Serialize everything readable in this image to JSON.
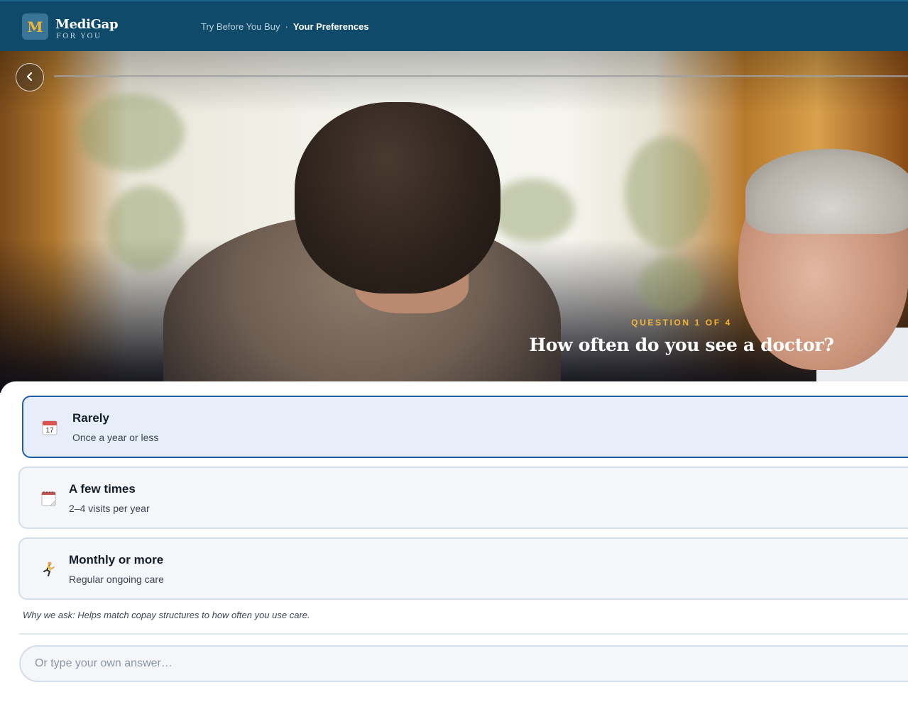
{
  "header": {
    "logo_letter": "M",
    "logo_name": "MediGap",
    "logo_sub": "FOR YOU",
    "breadcrumb": {
      "step1": "Try Before You Buy",
      "separator": "·",
      "step2": "Your Preferences"
    }
  },
  "hero": {
    "back_icon": "chevron-left-icon",
    "kicker": "QUESTION 1 OF 4",
    "question": "How often do you see a doctor?"
  },
  "options": [
    {
      "icon": "calendar-17-icon",
      "title": "Rarely",
      "subtitle": "Once a year or less",
      "selected": true
    },
    {
      "icon": "tear-off-calendar-icon",
      "title": "A few times",
      "subtitle": "2–4 visits per year",
      "selected": false
    },
    {
      "icon": "runner-icon",
      "title": "Monthly or more",
      "subtitle": "Regular ongoing care",
      "selected": false
    }
  ],
  "note": "Why we ask: Helps match copay structures to how often you use care.",
  "input": {
    "placeholder": "Or type your own answer…",
    "value": ""
  },
  "colors": {
    "header_bg": "#0f4a6b",
    "accent_gold": "#f2b431",
    "selected_border": "#1f5fa8",
    "selected_bg": "#e8eef9"
  }
}
